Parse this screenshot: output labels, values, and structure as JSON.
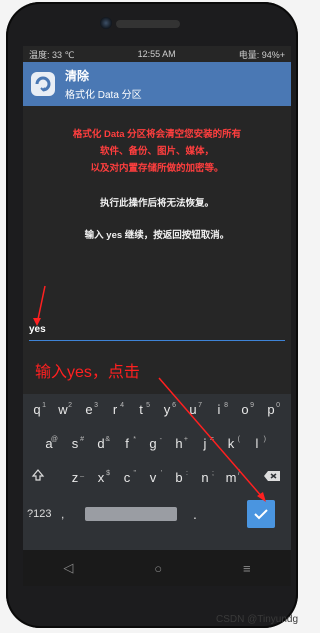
{
  "status_bar": {
    "left": "温度: 33 ℃",
    "center": "12:55 AM",
    "right": "电量: 94%+"
  },
  "header": {
    "title": "清除",
    "subtitle": "格式化 Data 分区"
  },
  "warning": {
    "line1": "格式化 Data 分区将会清空您安装的所有",
    "line2": "软件、备份、图片、媒体，",
    "line3": "以及对内置存储所做的加密等。"
  },
  "info": {
    "irreversible": "执行此操作后将无法恢复。",
    "instruction": "输入 yes 继续，按返回按钮取消。"
  },
  "input": {
    "value": "yes"
  },
  "annotation": {
    "text": "输入yes，点击"
  },
  "keyboard": {
    "row1": [
      {
        "k": "q",
        "n": "1"
      },
      {
        "k": "w",
        "n": "2"
      },
      {
        "k": "e",
        "n": "3"
      },
      {
        "k": "r",
        "n": "4"
      },
      {
        "k": "t",
        "n": "5"
      },
      {
        "k": "y",
        "n": "6"
      },
      {
        "k": "u",
        "n": "7"
      },
      {
        "k": "i",
        "n": "8"
      },
      {
        "k": "o",
        "n": "9"
      },
      {
        "k": "p",
        "n": "0"
      }
    ],
    "row2": [
      {
        "k": "a",
        "n": "@"
      },
      {
        "k": "s",
        "n": "#"
      },
      {
        "k": "d",
        "n": "&"
      },
      {
        "k": "f",
        "n": "*"
      },
      {
        "k": "g",
        "n": "-"
      },
      {
        "k": "h",
        "n": "+"
      },
      {
        "k": "j",
        "n": "="
      },
      {
        "k": "k",
        "n": "("
      },
      {
        "k": "l",
        "n": ")"
      }
    ],
    "row3": [
      {
        "k": "z",
        "n": "_"
      },
      {
        "k": "x",
        "n": "$"
      },
      {
        "k": "c",
        "n": "\""
      },
      {
        "k": "v",
        "n": "'"
      },
      {
        "k": "b",
        "n": ":"
      },
      {
        "k": "n",
        "n": ";"
      },
      {
        "k": "m",
        "n": "/"
      }
    ],
    "sym_label": "?123",
    "comma_label": ",",
    "period_label": ".",
    "shift_icon": "shift-arrow-icon",
    "delete_icon": "backspace-icon",
    "enter_icon": "checkmark-icon"
  },
  "nav": {
    "back": "◁",
    "home": "○",
    "recents": "≡"
  },
  "watermark": "CSDN @Tinyundg",
  "colors": {
    "header_bg": "#4a78b4",
    "warning_text": "#ff3e3e",
    "input_underline": "#3e83d6",
    "annotation": "#ff2020",
    "enter_key": "#4a95e0"
  }
}
